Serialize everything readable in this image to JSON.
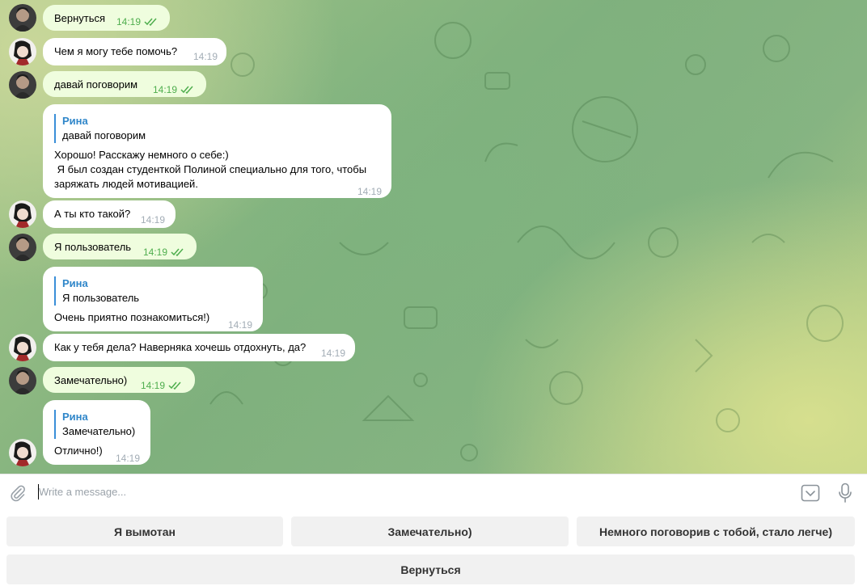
{
  "messages": [
    {
      "from": "user",
      "text": "Вернуться",
      "time": "14:19"
    },
    {
      "from": "bot",
      "text": "Чем я могу тебе помочь?",
      "time": "14:19"
    },
    {
      "from": "user",
      "text": "давай поговорим",
      "time": "14:19"
    },
    {
      "from": "bot",
      "reply_author": "Рина",
      "reply_quote": "давай поговорим",
      "text": "Хорошо! Расскажу немного о себе:)\n Я был создан студенткой Полиной специально для того, чтобы\nзаряжать людей мотивацией.",
      "time": "14:19"
    },
    {
      "from": "bot",
      "text": "А ты кто такой?",
      "time": "14:19"
    },
    {
      "from": "user",
      "text": "Я пользователь",
      "time": "14:19"
    },
    {
      "from": "bot",
      "reply_author": "Рина",
      "reply_quote": "Я пользователь",
      "text": "Очень приятно познакомиться!)",
      "time": "14:19"
    },
    {
      "from": "bot",
      "text": "Как у тебя дела? Наверняка хочешь отдохнуть, да?",
      "time": "14:19"
    },
    {
      "from": "user",
      "text": "Замечательно)",
      "time": "14:19"
    },
    {
      "from": "bot",
      "reply_author": "Рина",
      "reply_quote": "Замечательно)",
      "text": "Отлично!)",
      "time": "14:19"
    }
  ],
  "composer": {
    "placeholder": "Write a message...",
    "icons": {
      "attach": "paperclip-icon",
      "keyboard": "keyboard-toggle-icon",
      "mic": "microphone-icon"
    }
  },
  "keyboard": {
    "row1": [
      "Я вымотан",
      "Замечательно)",
      "Немного поговорив с тобой, стало легче)"
    ],
    "row2": [
      "Вернуться"
    ]
  },
  "colors": {
    "outgoing_bubble": "#effdde",
    "incoming_bubble": "#ffffff",
    "reply_accent": "#2f86c9",
    "read_checks": "#4fae4e"
  }
}
